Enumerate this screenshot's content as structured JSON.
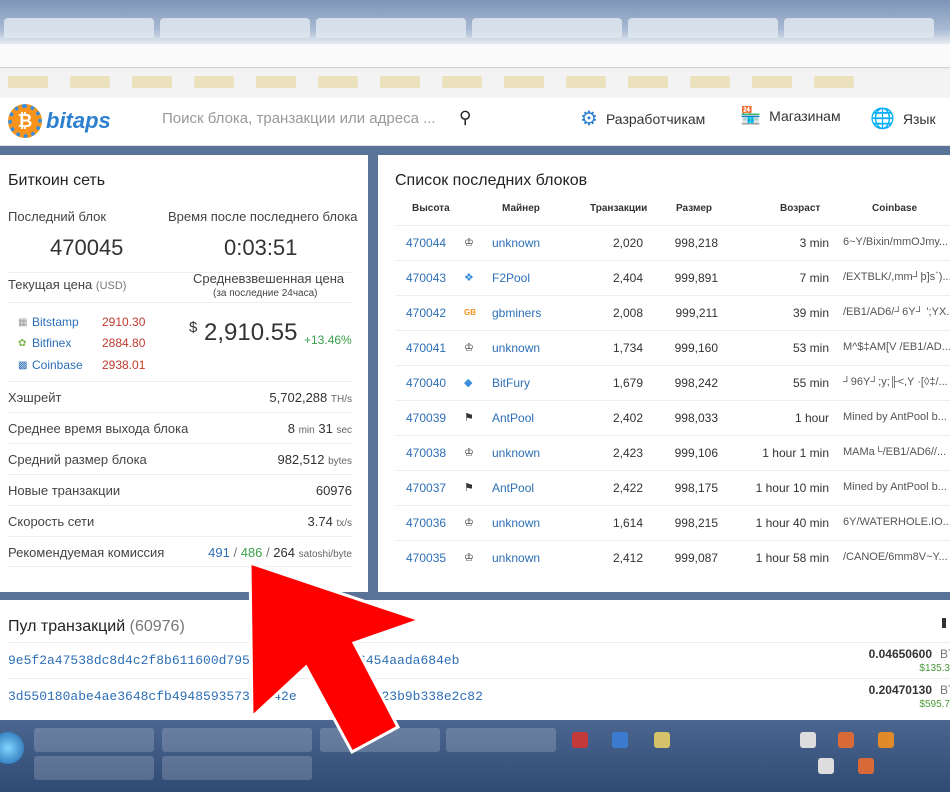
{
  "header": {
    "logo_text": "bitaps",
    "search_placeholder": "Поиск блока, транзакции или адреса ...",
    "nav": [
      {
        "label": "Разработчикам"
      },
      {
        "label": "Магазинам"
      },
      {
        "label": "Язык"
      }
    ]
  },
  "network": {
    "title": "Биткоин сеть",
    "last_block_label": "Последний блок",
    "last_block_value": "470045",
    "time_since_label": "Время после последнего блока",
    "time_since_value": "0:03:51",
    "price_label": "Текущая цена",
    "price_unit": "(USD)",
    "weighted_label": "Средневзвешенная цена",
    "weighted_sub": "(за последние 24часа)",
    "exchanges": [
      {
        "name": "Bitstamp",
        "price": "2910.30"
      },
      {
        "name": "Bitfinex",
        "price": "2884.80"
      },
      {
        "name": "Coinbase",
        "price": "2938.01"
      }
    ],
    "currency_symbol": "$",
    "weighted_price": "2,910.55",
    "change": "+13.46%",
    "stats": [
      {
        "label": "Хэшрейт",
        "value": "5,702,288",
        "unit": "TH/s"
      },
      {
        "label": "Среднее время выхода блока",
        "value": "8",
        "unit": "min",
        "value2": "31",
        "unit2": "sec"
      },
      {
        "label": "Средний размер блока",
        "value": "982,512",
        "unit": "bytes"
      },
      {
        "label": "Новые транзакции",
        "value": "60976",
        "unit": ""
      },
      {
        "label": "Скорость сети",
        "value": "3.74",
        "unit": "tx/s"
      }
    ],
    "fee": {
      "label": "Рекомендуемая комиссия",
      "high": "491",
      "mid": "486",
      "low": "264",
      "sep": "/",
      "unit": "satoshi/byte"
    }
  },
  "blocks": {
    "title": "Список последних блоков",
    "columns": [
      "Высота",
      "Майнер",
      "Транзакции",
      "Размер",
      "Возраст",
      "Coinbase"
    ],
    "rows": [
      {
        "height": "470044",
        "miner": "unknown",
        "tx": "2,020",
        "size": "998,218",
        "age": "3 min",
        "coinbase": "6~Y/Bixin/mmOJmy..."
      },
      {
        "height": "470043",
        "miner": "F2Pool",
        "tx": "2,404",
        "size": "999,891",
        "age": "7 min",
        "coinbase": "/EXTBLK/,mm┘þ]s`)..."
      },
      {
        "height": "470042",
        "miner": "gbminers",
        "tx": "2,008",
        "size": "999,211",
        "age": "39 min",
        "coinbase": "/EB1/AD6/┘6Y┘ ';YX..."
      },
      {
        "height": "470041",
        "miner": "unknown",
        "tx": "1,734",
        "size": "999,160",
        "age": "53 min",
        "coinbase": "M^$‡AM[V /EB1/AD..."
      },
      {
        "height": "470040",
        "miner": "BitFury",
        "tx": "1,679",
        "size": "998,242",
        "age": "55 min",
        "coinbase": "┘96Y┘;y;╟<,Y ·[◊‡/..."
      },
      {
        "height": "470039",
        "miner": "AntPool",
        "tx": "2,402",
        "size": "998,033",
        "age": "1 hour",
        "coinbase": "Mined by AntPool b..."
      },
      {
        "height": "470038",
        "miner": "unknown",
        "tx": "2,423",
        "size": "999,106",
        "age": "1 hour 1 min",
        "coinbase": "MAMa└/EB1/AD6//..."
      },
      {
        "height": "470037",
        "miner": "AntPool",
        "tx": "2,422",
        "size": "998,175",
        "age": "1 hour 10 min",
        "coinbase": "Mined by AntPool b..."
      },
      {
        "height": "470036",
        "miner": "unknown",
        "tx": "1,614",
        "size": "998,215",
        "age": "1 hour 40 min",
        "coinbase": "6Y/WATERHOLE.IO..."
      },
      {
        "height": "470035",
        "miner": "unknown",
        "tx": "2,412",
        "size": "999,087",
        "age": "1 hour 58 min",
        "coinbase": "/CANOE/6mm8V~Y..."
      }
    ]
  },
  "pool": {
    "title": "Пул транзакций",
    "count": "(60976)",
    "rows": [
      {
        "hash": "9e5f2a47538dc8d4c2f8b611600d795c53d",
        "hash_tail": "43bbc6454aada684eb",
        "amount": "0.04650600",
        "unit": "BTC",
        "usd": "$135.3"
      },
      {
        "hash": "3d550180abe4ae3648cfb49485935731f042e",
        "hash_tail": "77f43423b9b338e2c82",
        "amount": "0.20470130",
        "unit": "BTC",
        "usd": "$595.7"
      }
    ]
  },
  "colors": {
    "link": "#2d6fb6",
    "positive": "#3aa04a",
    "negative": "#c0392b",
    "arrow": "#ff0000"
  }
}
